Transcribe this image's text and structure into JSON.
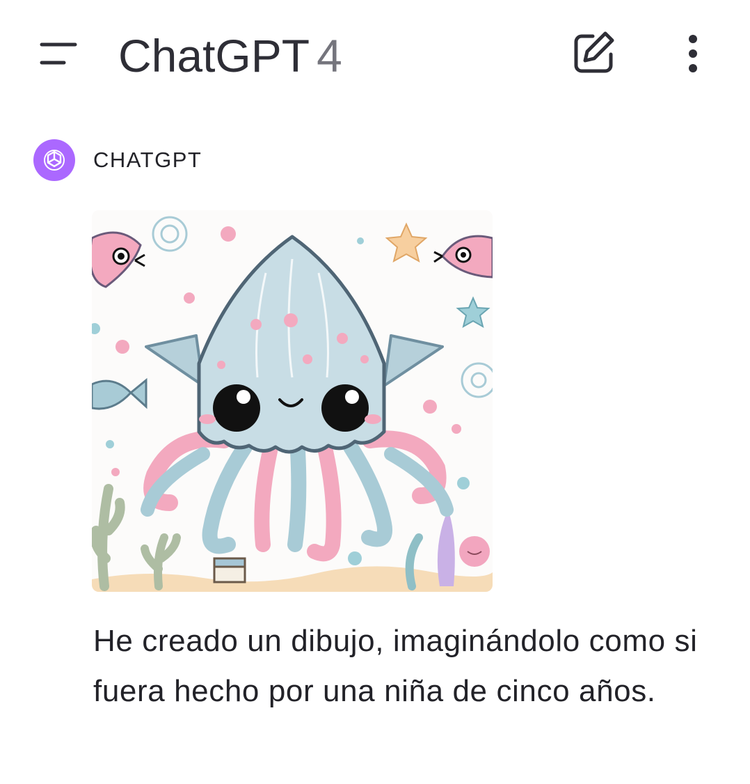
{
  "header": {
    "title": "ChatGPT",
    "model": "4",
    "menu_icon": "hamburger-menu-icon",
    "edit_icon": "new-chat-edit-icon",
    "more_icon": "more-vertical-icon"
  },
  "message": {
    "sender": "CHATGPT",
    "avatar_icon": "openai-logo-icon",
    "avatar_color": "#ab68ff",
    "image_subject": "squid-drawing",
    "text": "He creado un dibujo, imaginándolo como si fuera hecho por una niña de cinco años."
  }
}
